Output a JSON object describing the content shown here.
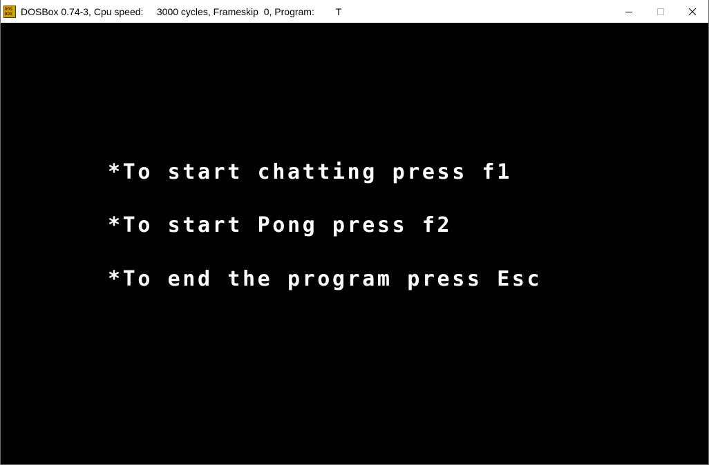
{
  "window": {
    "title": "DOSBox 0.74-3, Cpu speed:     3000 cycles, Frameskip  0, Program:        T",
    "icon": "dosbox-app-icon",
    "icon_text_top": "DOS",
    "icon_text_bottom": "BOX",
    "controls": [
      "minimize-icon",
      "maximize-icon",
      "close-icon"
    ]
  },
  "screen": {
    "background": "#000000",
    "text_color": "#ffffff",
    "lines": [
      "*To start chatting press f1",
      "*To start Pong press f2",
      "*To end the program press Esc"
    ]
  }
}
